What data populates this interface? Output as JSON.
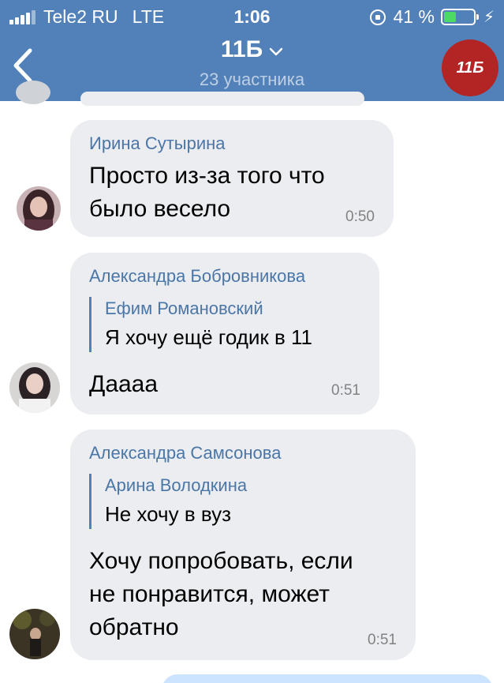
{
  "status_bar": {
    "carrier": "Tele2 RU",
    "network": "LTE",
    "time": "1:06",
    "battery": "41 %",
    "battery_level": 0.41
  },
  "header": {
    "title": "11Б",
    "subtitle": "23 участника",
    "avatar_text": "11Б"
  },
  "messages": [
    {
      "sender": "Ирина Сутырина",
      "text_lines": [
        "Просто из-за того что",
        "было весело"
      ],
      "time": "0:50"
    },
    {
      "sender": "Александра Бобровникова",
      "quote": {
        "author": "Ефим Романовский",
        "text": "Я хочу ещё годик в 11"
      },
      "text_lines": [
        "Даааа"
      ],
      "time": "0:51"
    },
    {
      "sender": "Александра Самсонова",
      "quote": {
        "author": "Арина Володкина",
        "text": "Не хочу в вуз"
      },
      "text_lines": [
        "Хочу попробовать, если",
        "не понравится, может",
        "обратно"
      ],
      "time": "0:51"
    }
  ],
  "colors": {
    "header": "#5181b8",
    "bubble": "#ebedf0",
    "sender": "#4a76a8",
    "group_avatar": "#b32424"
  }
}
